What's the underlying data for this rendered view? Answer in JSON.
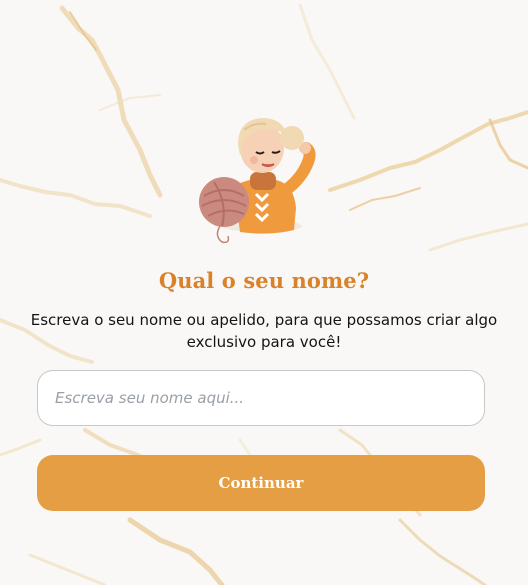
{
  "screen": {
    "title": "Qual o seu nome?",
    "subtitle": "Escreva o seu nome ou apelido, para que possamos criar algo exclusivo para você!",
    "illustration": "girl-holding-yarn-ball-illustration"
  },
  "form": {
    "name_placeholder": "Escreva seu nome aqui...",
    "name_value": ""
  },
  "actions": {
    "continue_label": "Continuar"
  },
  "theme": {
    "accent": "#e59e43",
    "title_color": "#d9822b",
    "background": "#f9f8f6"
  }
}
